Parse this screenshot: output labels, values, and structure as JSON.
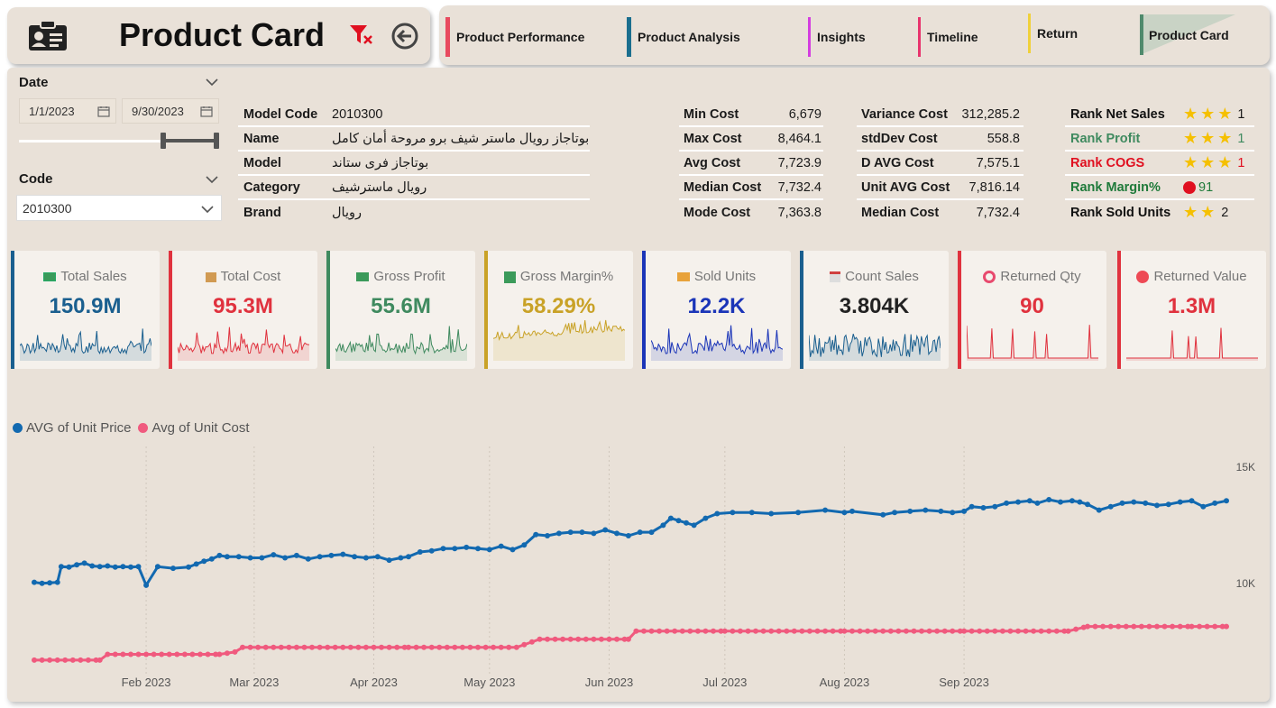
{
  "colors": {
    "panel": "#e9e1d8",
    "blue": "#1269b0",
    "pink": "#f05a7e",
    "red": "#e0323e",
    "green": "#3f8a5f",
    "gold": "#c9a227",
    "navy": "#1b35b8",
    "darkblue": "#1a5f8f"
  },
  "header": {
    "title": "Product Card",
    "icon": "id-card-icon",
    "filter_icon": "clear-filter-icon",
    "back_icon": "back-arrow-icon"
  },
  "nav": [
    {
      "label": "Product Performance",
      "color": "#e84a5f"
    },
    {
      "label": "Product Analysis",
      "color": "#1a6e8e"
    },
    {
      "label": "Insights",
      "color": "#d43de0"
    },
    {
      "label": "Timeline",
      "color": "#e8336d"
    },
    {
      "label": "Return",
      "color": "#f0d03a"
    },
    {
      "label": "Product Card",
      "color": "#4f8a6c"
    }
  ],
  "date_slicer": {
    "title": "Date",
    "start": "1/1/2023",
    "end": "9/30/2023"
  },
  "code_slicer": {
    "title": "Code",
    "value": "2010300"
  },
  "product_info": [
    {
      "label": "Model Code",
      "value": "2010300"
    },
    {
      "label": "Name",
      "value": "بوتاجاز رويال ماستر شيف برو مروحة أمان كامل"
    },
    {
      "label": "Model",
      "value": "بوتاجاز فرى ستاند"
    },
    {
      "label": "Category",
      "value": "رويال ماسترشيف"
    },
    {
      "label": "Brand",
      "value": "رويال"
    }
  ],
  "cost_stats": [
    {
      "label": "Min Cost",
      "value": "6,679"
    },
    {
      "label": "Max Cost",
      "value": "8,464.1"
    },
    {
      "label": "Avg Cost",
      "value": "7,723.9"
    },
    {
      "label": "Median Cost",
      "value": "7,732.4"
    },
    {
      "label": "Mode Cost",
      "value": "7,363.8"
    }
  ],
  "cost_stats2": [
    {
      "label": "Variance Cost",
      "value": "312,285.2"
    },
    {
      "label": "stdDev Cost",
      "value": "558.8"
    },
    {
      "label": "D AVG Cost",
      "value": "7,575.1"
    },
    {
      "label": "Unit AVG Cost",
      "value": "7,816.14"
    },
    {
      "label": "Median Cost",
      "value": "7,732.4"
    }
  ],
  "ranks": [
    {
      "label": "Rank Net Sales",
      "color": "#111111",
      "stars": 3,
      "value": "1"
    },
    {
      "label": "Rank Profit",
      "color": "#3f8a5f",
      "stars": 3,
      "value": "1"
    },
    {
      "label": "Rank COGS",
      "color": "#e01020",
      "stars": 3,
      "value": "1"
    },
    {
      "label": "Rank Margin%",
      "color": "#1f7a3a",
      "stars": 0,
      "dot": true,
      "value": "91"
    },
    {
      "label": "Rank Sold Units",
      "color": "#111111",
      "stars": 2,
      "value": "2"
    }
  ],
  "kpis": [
    {
      "title": "Total Sales",
      "value": "150.9M",
      "color": "#1a5f8f",
      "icon": "money-icon"
    },
    {
      "title": "Total Cost",
      "value": "95.3M",
      "color": "#e0323e",
      "icon": "box-icon"
    },
    {
      "title": "Gross Profit",
      "value": "55.6M",
      "color": "#3f8a5f",
      "icon": "cash-icon"
    },
    {
      "title": "Gross Margin%",
      "value": "58.29%",
      "color": "#c9a227",
      "icon": "percent-icon"
    },
    {
      "title": "Sold Units",
      "value": "12.2K",
      "color": "#1b35b8",
      "icon": "truck-icon"
    },
    {
      "title": "Count Sales",
      "value": "3.804K",
      "color": "#1a5f8f",
      "icon": "calendar-icon"
    },
    {
      "title": "Returned Qty",
      "value": "90",
      "color": "#e0323e",
      "icon": "ring-icon"
    },
    {
      "title": "Returned Value",
      "value": "1.3M",
      "color": "#e0323e",
      "icon": "red-dot-icon"
    }
  ],
  "chart_data": {
    "type": "line",
    "series": [
      {
        "name": "AVG of Unit Price",
        "color": "#1269b0",
        "points": [
          [
            "2023-01-03",
            10050
          ],
          [
            "2023-01-05",
            10000
          ],
          [
            "2023-01-07",
            10020
          ],
          [
            "2023-01-09",
            10050
          ],
          [
            "2023-01-10",
            10720
          ],
          [
            "2023-01-12",
            10700
          ],
          [
            "2023-01-14",
            10800
          ],
          [
            "2023-01-16",
            10870
          ],
          [
            "2023-01-18",
            10750
          ],
          [
            "2023-01-20",
            10720
          ],
          [
            "2023-01-22",
            10750
          ],
          [
            "2023-01-24",
            10700
          ],
          [
            "2023-01-26",
            10720
          ],
          [
            "2023-01-28",
            10700
          ],
          [
            "2023-01-30",
            10720
          ],
          [
            "2023-02-01",
            9920
          ],
          [
            "2023-02-04",
            10720
          ],
          [
            "2023-02-08",
            10650
          ],
          [
            "2023-02-12",
            10700
          ],
          [
            "2023-02-14",
            10830
          ],
          [
            "2023-02-16",
            10950
          ],
          [
            "2023-02-18",
            11050
          ],
          [
            "2023-02-20",
            11200
          ],
          [
            "2023-02-22",
            11150
          ],
          [
            "2023-02-25",
            11150
          ],
          [
            "2023-02-28",
            11100
          ],
          [
            "2023-03-03",
            11100
          ],
          [
            "2023-03-06",
            11230
          ],
          [
            "2023-03-09",
            11100
          ],
          [
            "2023-03-12",
            11200
          ],
          [
            "2023-03-15",
            11050
          ],
          [
            "2023-03-18",
            11150
          ],
          [
            "2023-03-21",
            11200
          ],
          [
            "2023-03-24",
            11250
          ],
          [
            "2023-03-27",
            11150
          ],
          [
            "2023-03-30",
            11100
          ],
          [
            "2023-04-02",
            11150
          ],
          [
            "2023-04-05",
            11000
          ],
          [
            "2023-04-08",
            11100
          ],
          [
            "2023-04-10",
            11150
          ],
          [
            "2023-04-13",
            11350
          ],
          [
            "2023-04-16",
            11400
          ],
          [
            "2023-04-19",
            11500
          ],
          [
            "2023-04-22",
            11500
          ],
          [
            "2023-04-25",
            11550
          ],
          [
            "2023-04-28",
            11500
          ],
          [
            "2023-05-01",
            11450
          ],
          [
            "2023-05-04",
            11600
          ],
          [
            "2023-05-07",
            11450
          ],
          [
            "2023-05-10",
            11650
          ],
          [
            "2023-05-13",
            12100
          ],
          [
            "2023-05-16",
            12050
          ],
          [
            "2023-05-19",
            12150
          ],
          [
            "2023-05-22",
            12200
          ],
          [
            "2023-05-25",
            12200
          ],
          [
            "2023-05-28",
            12150
          ],
          [
            "2023-05-31",
            12300
          ],
          [
            "2023-06-03",
            12150
          ],
          [
            "2023-06-06",
            12050
          ],
          [
            "2023-06-09",
            12200
          ],
          [
            "2023-06-12",
            12200
          ],
          [
            "2023-06-15",
            12500
          ],
          [
            "2023-06-17",
            12800
          ],
          [
            "2023-06-19",
            12700
          ],
          [
            "2023-06-21",
            12600
          ],
          [
            "2023-06-23",
            12500
          ],
          [
            "2023-06-26",
            12800
          ],
          [
            "2023-06-29",
            13000
          ],
          [
            "2023-07-03",
            13050
          ],
          [
            "2023-07-08",
            13050
          ],
          [
            "2023-07-13",
            13000
          ],
          [
            "2023-07-20",
            13050
          ],
          [
            "2023-07-27",
            13150
          ],
          [
            "2023-08-01",
            13050
          ],
          [
            "2023-08-03",
            13100
          ],
          [
            "2023-08-11",
            12950
          ],
          [
            "2023-08-14",
            13050
          ],
          [
            "2023-08-18",
            13100
          ],
          [
            "2023-08-22",
            13150
          ],
          [
            "2023-08-26",
            13100
          ],
          [
            "2023-08-29",
            13050
          ],
          [
            "2023-09-01",
            13100
          ],
          [
            "2023-09-03",
            13300
          ],
          [
            "2023-09-06",
            13250
          ],
          [
            "2023-09-09",
            13300
          ],
          [
            "2023-09-12",
            13450
          ],
          [
            "2023-09-15",
            13500
          ],
          [
            "2023-09-18",
            13550
          ],
          [
            "2023-09-20",
            13450
          ],
          [
            "2023-09-23",
            13600
          ],
          [
            "2023-09-26",
            13500
          ],
          [
            "2023-09-29",
            13550
          ],
          [
            "2023-10-01",
            13500
          ],
          [
            "2023-10-03",
            13400
          ],
          [
            "2023-10-06",
            13150
          ],
          [
            "2023-10-09",
            13300
          ],
          [
            "2023-10-12",
            13450
          ],
          [
            "2023-10-15",
            13500
          ],
          [
            "2023-10-18",
            13450
          ],
          [
            "2023-10-21",
            13350
          ],
          [
            "2023-10-24",
            13400
          ],
          [
            "2023-10-27",
            13500
          ],
          [
            "2023-10-30",
            13550
          ],
          [
            "2023-11-02",
            13300
          ],
          [
            "2023-11-05",
            13450
          ],
          [
            "2023-11-08",
            13550
          ]
        ]
      },
      {
        "name": "Avg of Unit Cost",
        "color": "#f05a7e",
        "points": [
          [
            "2023-01-03",
            6700
          ],
          [
            "2023-01-20",
            6700
          ],
          [
            "2023-01-22",
            6950
          ],
          [
            "2023-02-20",
            6950
          ],
          [
            "2023-02-24",
            7050
          ],
          [
            "2023-02-26",
            7250
          ],
          [
            "2023-04-01",
            7250
          ],
          [
            "2023-04-10",
            7250
          ],
          [
            "2023-05-04",
            7250
          ],
          [
            "2023-05-08",
            7250
          ],
          [
            "2023-05-14",
            7600
          ],
          [
            "2023-05-28",
            7600
          ],
          [
            "2023-06-06",
            7600
          ],
          [
            "2023-06-08",
            7950
          ],
          [
            "2023-07-01",
            7950
          ],
          [
            "2023-08-01",
            7950
          ],
          [
            "2023-09-01",
            7950
          ],
          [
            "2023-09-28",
            7950
          ],
          [
            "2023-10-03",
            8150
          ],
          [
            "2023-10-30",
            8150
          ],
          [
            "2023-11-08",
            8150
          ]
        ]
      }
    ],
    "x_ticks": [
      "Feb 2023",
      "Mar 2023",
      "Apr 2023",
      "May 2023",
      "Jun 2023",
      "Jul 2023",
      "Aug 2023",
      "Sep 2023"
    ],
    "y_ticks": [
      "15K",
      "10K"
    ],
    "ylim": [
      6000,
      15500
    ]
  }
}
